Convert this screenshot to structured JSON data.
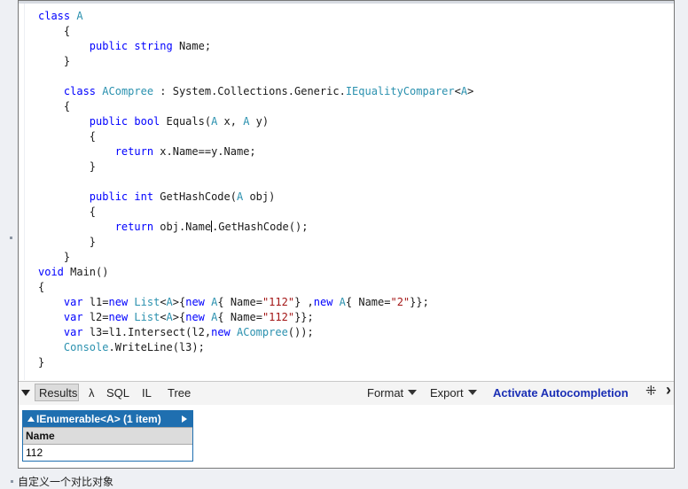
{
  "code_lines": [
    [
      [
        "t-kw",
        "class "
      ],
      [
        "t-type",
        "A"
      ]
    ],
    [
      [
        "t-plain",
        "    {"
      ]
    ],
    [
      [
        "t-plain",
        "        "
      ],
      [
        "t-kw",
        "public "
      ],
      [
        "t-kw",
        "string "
      ],
      [
        "t-plain",
        "Name;"
      ]
    ],
    [
      [
        "t-plain",
        "    }"
      ]
    ],
    [
      [
        "t-plain",
        ""
      ]
    ],
    [
      [
        "t-plain",
        "    "
      ],
      [
        "t-kw",
        "class "
      ],
      [
        "t-type",
        "ACompree"
      ],
      [
        "t-plain",
        " : System.Collections.Generic."
      ],
      [
        "t-type",
        "IEqualityComparer"
      ],
      [
        "t-plain",
        "<"
      ],
      [
        "t-type",
        "A"
      ],
      [
        "t-plain",
        ">"
      ]
    ],
    [
      [
        "t-plain",
        "    {"
      ]
    ],
    [
      [
        "t-plain",
        "        "
      ],
      [
        "t-kw",
        "public "
      ],
      [
        "t-kw",
        "bool "
      ],
      [
        "t-plain",
        "Equals("
      ],
      [
        "t-type",
        "A"
      ],
      [
        "t-plain",
        " x, "
      ],
      [
        "t-type",
        "A"
      ],
      [
        "t-plain",
        " y)"
      ]
    ],
    [
      [
        "t-plain",
        "        {"
      ]
    ],
    [
      [
        "t-plain",
        "            "
      ],
      [
        "t-kw",
        "return "
      ],
      [
        "t-plain",
        "x.Name==y.Name;"
      ]
    ],
    [
      [
        "t-plain",
        "        }"
      ]
    ],
    [
      [
        "t-plain",
        ""
      ]
    ],
    [
      [
        "t-plain",
        "        "
      ],
      [
        "t-kw",
        "public "
      ],
      [
        "t-kw",
        "int "
      ],
      [
        "t-plain",
        "GetHashCode("
      ],
      [
        "t-type",
        "A"
      ],
      [
        "t-plain",
        " obj)"
      ]
    ],
    [
      [
        "t-plain",
        "        {"
      ]
    ],
    [
      [
        "t-plain",
        "            "
      ],
      [
        "t-kw",
        "return "
      ],
      [
        "t-plain",
        "obj.Name"
      ],
      [
        "caret",
        ""
      ],
      [
        "t-plain",
        ".GetHashCode();"
      ]
    ],
    [
      [
        "t-plain",
        "        }"
      ]
    ],
    [
      [
        "t-plain",
        "    }"
      ]
    ],
    [
      [
        "t-kw",
        "void "
      ],
      [
        "t-plain",
        "Main()"
      ]
    ],
    [
      [
        "t-plain",
        "{"
      ]
    ],
    [
      [
        "t-plain",
        "    "
      ],
      [
        "t-kw",
        "var "
      ],
      [
        "t-plain",
        "l1="
      ],
      [
        "t-kw",
        "new "
      ],
      [
        "t-type",
        "List"
      ],
      [
        "t-plain",
        "<"
      ],
      [
        "t-type",
        "A"
      ],
      [
        "t-plain",
        ">{"
      ],
      [
        "t-kw",
        "new "
      ],
      [
        "t-type",
        "A"
      ],
      [
        "t-plain",
        "{ Name="
      ],
      [
        "t-str",
        "\"112\""
      ],
      [
        "t-plain",
        "} ,"
      ],
      [
        "t-kw",
        "new "
      ],
      [
        "t-type",
        "A"
      ],
      [
        "t-plain",
        "{ Name="
      ],
      [
        "t-str",
        "\"2\""
      ],
      [
        "t-plain",
        "}};"
      ]
    ],
    [
      [
        "t-plain",
        "    "
      ],
      [
        "t-kw",
        "var "
      ],
      [
        "t-plain",
        "l2="
      ],
      [
        "t-kw",
        "new "
      ],
      [
        "t-type",
        "List"
      ],
      [
        "t-plain",
        "<"
      ],
      [
        "t-type",
        "A"
      ],
      [
        "t-plain",
        ">{"
      ],
      [
        "t-kw",
        "new "
      ],
      [
        "t-type",
        "A"
      ],
      [
        "t-plain",
        "{ Name="
      ],
      [
        "t-str",
        "\"112\""
      ],
      [
        "t-plain",
        "}};"
      ]
    ],
    [
      [
        "t-plain",
        "    "
      ],
      [
        "t-kw",
        "var "
      ],
      [
        "t-plain",
        "l3=l1.Intersect(l2,"
      ],
      [
        "t-kw",
        "new "
      ],
      [
        "t-type",
        "ACompree"
      ],
      [
        "t-plain",
        "());"
      ]
    ],
    [
      [
        "t-plain",
        "    "
      ],
      [
        "t-type",
        "Console"
      ],
      [
        "t-plain",
        ".WriteLine(l3);"
      ]
    ],
    [
      [
        "t-plain",
        "}"
      ]
    ]
  ],
  "toolbar": {
    "results": "Results",
    "lambda": "λ",
    "sql": "SQL",
    "il": "IL",
    "tree": "Tree",
    "format": "Format",
    "export": "Export",
    "autocomplete": "Activate Autocompletion",
    "spinner_glyph": "⁜",
    "more_glyph": "›"
  },
  "result": {
    "header": "IEnumerable<A> (1 item)",
    "column": "Name",
    "cell": "112"
  },
  "caption": "自定义一个对比对象"
}
